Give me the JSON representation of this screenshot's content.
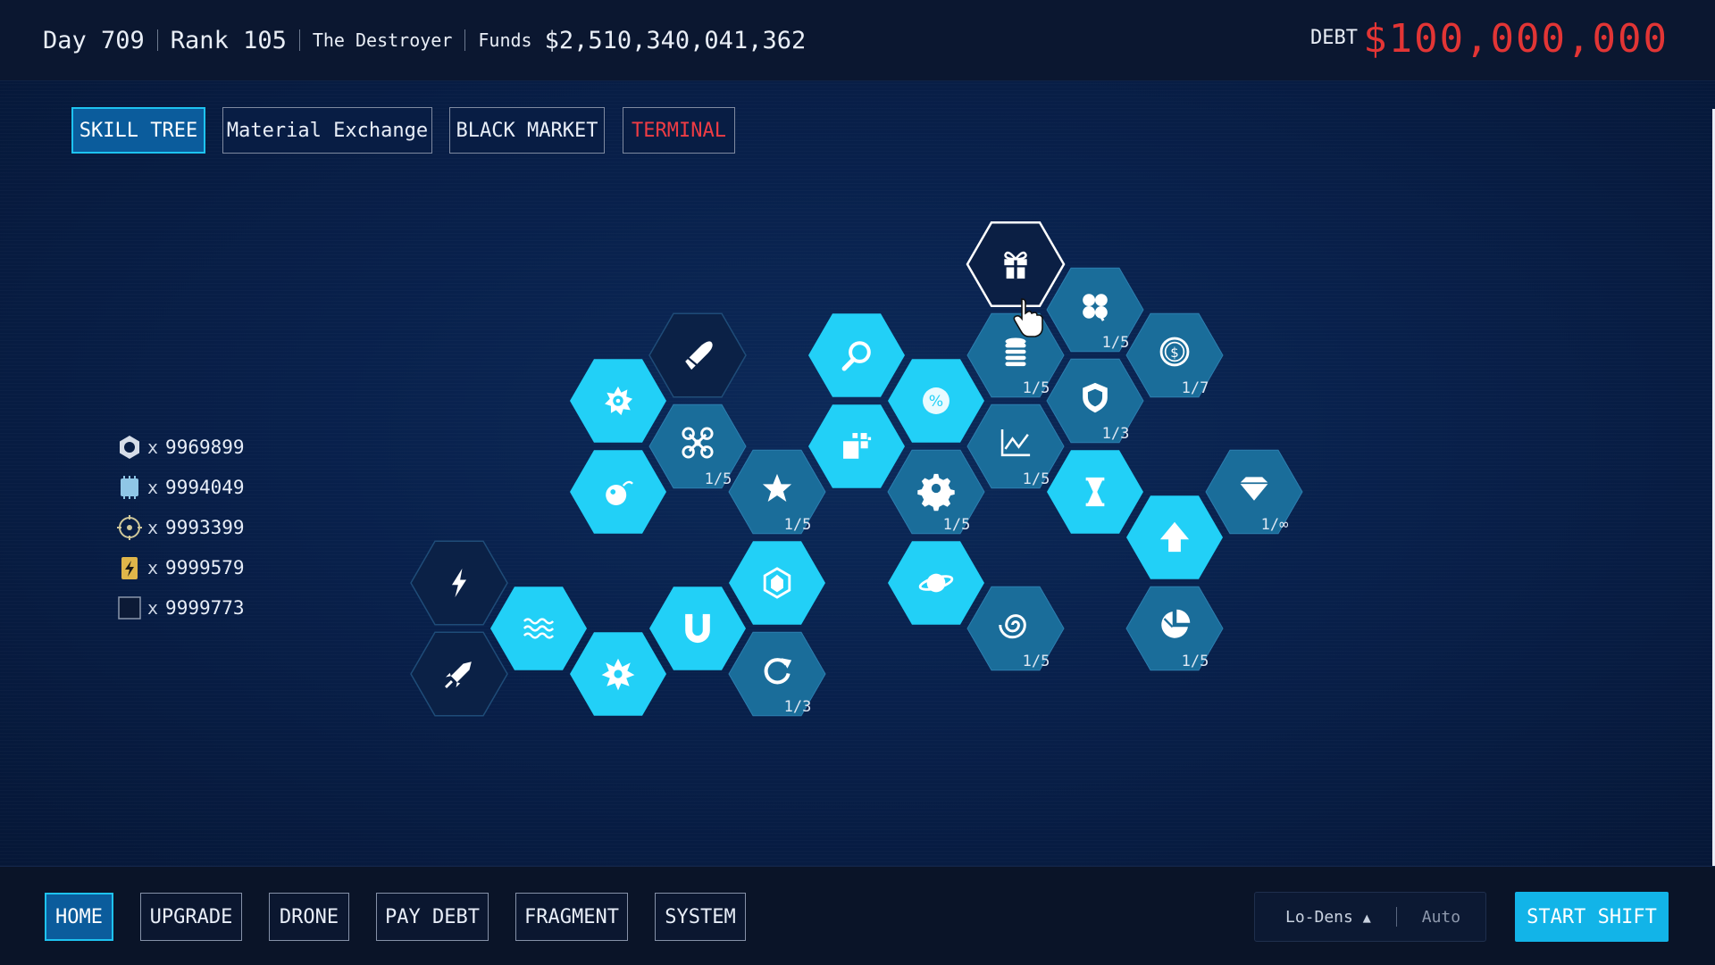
{
  "header": {
    "day": "Day 709",
    "rank": "Rank 105",
    "title": "The Destroyer",
    "funds_label": "Funds",
    "funds_value": "$2,510,340,041,362",
    "debt_label": "DEBT",
    "debt_value": "$100,000,000"
  },
  "tabs": [
    {
      "label": "SKILL TREE",
      "active": true
    },
    {
      "label": "Material Exchange",
      "active": false
    },
    {
      "label": "BLACK MARKET",
      "active": false
    },
    {
      "label": "TERMINAL",
      "active": false,
      "color": "#ef3c44"
    }
  ],
  "materials": [
    {
      "icon": "hex-nut-icon",
      "count": "9969899"
    },
    {
      "icon": "chip-icon",
      "count": "9994049"
    },
    {
      "icon": "crosshair-core-icon",
      "count": "9993399"
    },
    {
      "icon": "battery-icon",
      "count": "9999579"
    },
    {
      "icon": "dark-cube-icon",
      "count": "9999773"
    }
  ],
  "skills": [
    {
      "id": "lightning",
      "icon": "lightning-icon",
      "state": "locked",
      "level": ""
    },
    {
      "id": "rocket",
      "icon": "rocket-icon",
      "state": "locked",
      "level": ""
    },
    {
      "id": "waves",
      "icon": "waves-icon",
      "state": "maxed",
      "level": ""
    },
    {
      "id": "sawblade",
      "icon": "sawblade-icon",
      "state": "maxed",
      "level": ""
    },
    {
      "id": "bomb",
      "icon": "bomb-icon",
      "state": "maxed",
      "level": ""
    },
    {
      "id": "explosion",
      "icon": "explosion-icon",
      "state": "maxed",
      "level": ""
    },
    {
      "id": "bullet",
      "icon": "bullet-icon",
      "state": "locked",
      "level": ""
    },
    {
      "id": "drone",
      "icon": "drone-icon",
      "state": "partial",
      "level": "1/5"
    },
    {
      "id": "magnet",
      "icon": "magnet-icon",
      "state": "maxed",
      "level": ""
    },
    {
      "id": "star",
      "icon": "star-icon",
      "state": "partial",
      "level": "1/5"
    },
    {
      "id": "crystal",
      "icon": "crystal-icon",
      "state": "maxed",
      "level": ""
    },
    {
      "id": "reload",
      "icon": "reload-icon",
      "state": "partial",
      "level": "1/3"
    },
    {
      "id": "search",
      "icon": "search-icon",
      "state": "maxed",
      "level": ""
    },
    {
      "id": "blocks",
      "icon": "blocks-icon",
      "state": "maxed",
      "level": ""
    },
    {
      "id": "percent",
      "icon": "percent-icon",
      "state": "maxed",
      "level": ""
    },
    {
      "id": "gear",
      "icon": "gear-icon",
      "state": "partial",
      "level": "1/5"
    },
    {
      "id": "planet",
      "icon": "planet-icon",
      "state": "maxed",
      "level": ""
    },
    {
      "id": "gift",
      "icon": "gift-icon",
      "state": "selected",
      "level": ""
    },
    {
      "id": "coins",
      "icon": "coin-stack-icon",
      "state": "partial",
      "level": "1/5"
    },
    {
      "id": "chart",
      "icon": "chart-icon",
      "state": "partial",
      "level": "1/5"
    },
    {
      "id": "vortex",
      "icon": "vortex-icon",
      "state": "partial",
      "level": "1/5"
    },
    {
      "id": "clover",
      "icon": "clover-icon",
      "state": "partial",
      "level": "1/5"
    },
    {
      "id": "shield",
      "icon": "shield-icon",
      "state": "partial",
      "level": "1/3"
    },
    {
      "id": "hourglass",
      "icon": "hourglass-icon",
      "state": "maxed",
      "level": ""
    },
    {
      "id": "dollar",
      "icon": "dollar-coin-icon",
      "state": "partial",
      "level": "1/7"
    },
    {
      "id": "arrow",
      "icon": "arrow-up-icon",
      "state": "maxed",
      "level": ""
    },
    {
      "id": "piechart",
      "icon": "pie-chart-icon",
      "state": "partial",
      "level": "1/5"
    },
    {
      "id": "diamond",
      "icon": "diamond-icon",
      "state": "partial",
      "level": "1/∞"
    }
  ],
  "bottom_nav": [
    {
      "label": "HOME",
      "active": true
    },
    {
      "label": "UPGRADE",
      "active": false
    },
    {
      "label": "DRONE",
      "active": false
    },
    {
      "label": "PAY DEBT",
      "active": false
    },
    {
      "label": "FRAGMENT",
      "active": false
    },
    {
      "label": "SYSTEM",
      "active": false
    }
  ],
  "density": {
    "label": "Lo-Dens",
    "mode": "Auto"
  },
  "start_shift_label": "START SHIFT",
  "colors": {
    "maxed": "#22d0f7",
    "partial": "#1a6d9a",
    "locked": "#0b2146",
    "accent": "#12b4e8",
    "debt": "#e23535"
  }
}
